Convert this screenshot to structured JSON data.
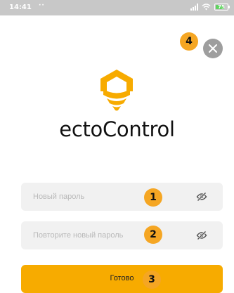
{
  "status_bar": {
    "time": "14:41",
    "dots": "··",
    "battery_level": "75",
    "icons": [
      "signal-icon",
      "wifi-icon",
      "battery-icon"
    ]
  },
  "brand": {
    "name": "ectoControl",
    "logo_icon": "ectocontrol-logo-icon",
    "color": "#F7AB00"
  },
  "form": {
    "new_password": {
      "placeholder": "Новый пароль",
      "value": "",
      "toggle_icon": "eye-slash-icon"
    },
    "repeat_password": {
      "placeholder": "Повторите новый пароль",
      "value": "",
      "toggle_icon": "eye-slash-icon"
    },
    "submit_label": "Готово"
  },
  "close_icon": "close-icon",
  "annotations": {
    "badge_1": "1",
    "badge_2": "2",
    "badge_3": "3",
    "badge_4": "4",
    "color": "#F5A623"
  }
}
